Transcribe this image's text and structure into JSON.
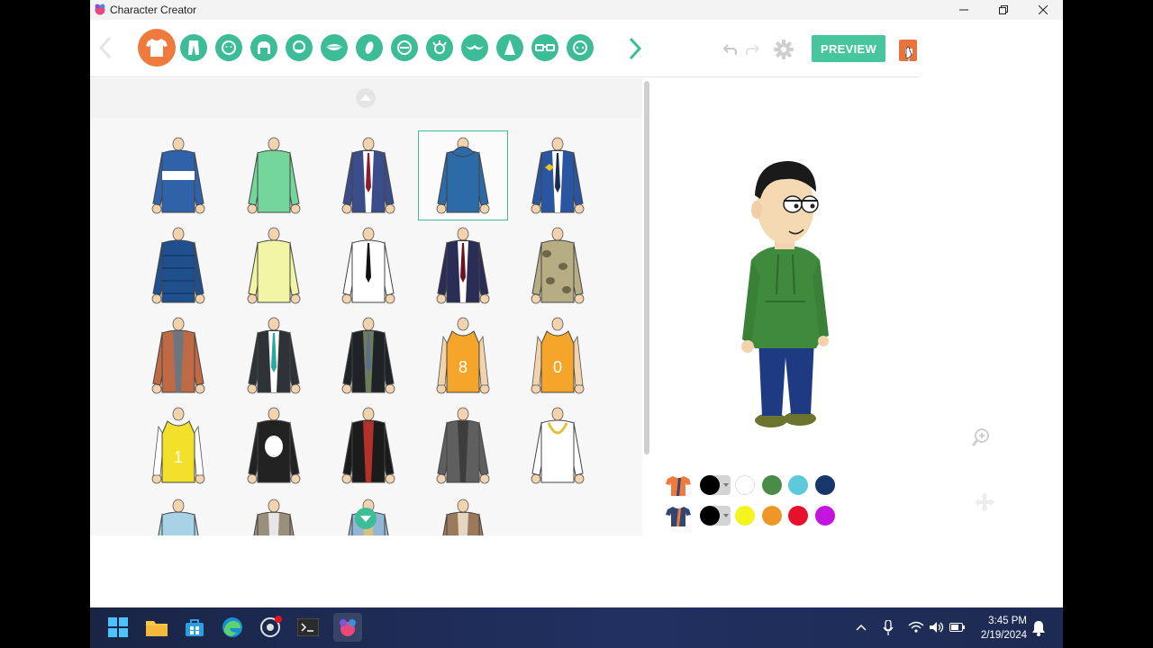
{
  "window": {
    "title": "Character Creator"
  },
  "toolbar": {
    "categories": [
      "shirt-icon",
      "pants-icon",
      "face-shape-icon",
      "hair-icon",
      "beard-icon",
      "mouth-icon",
      "nose-icon",
      "eyebrow-icon",
      "eyes-icon",
      "eyelashes-icon",
      "hat-icon",
      "glasses-icon",
      "accessory-icon"
    ],
    "preview_label": "PREVIEW"
  },
  "closet": {
    "selected_index": 3,
    "items": [
      "striped-polo-shirt",
      "green-tshirt",
      "suit-jacket-red-tie",
      "blue-hoodie",
      "police-uniform",
      "puffer-jacket",
      "yellow-button-shirt",
      "tuxedo-white-shirt",
      "dark-tuxedo",
      "camo-hunter-jacket",
      "brown-overalls-shirt",
      "dark-suit-teal-tie",
      "zombie-suit",
      "orange-jersey-8",
      "orange-jersey-0",
      "yellow-jersey-1",
      "skull-tshirt",
      "biker-leather-jacket",
      "grey-robe",
      "white-tshirt-gold-chain",
      "light-blue-shirt",
      "vest-outfit",
      "denim-jacket",
      "brown-coat"
    ]
  },
  "colors": {
    "row1": [
      "#000000",
      "#ffffff",
      "#4a8b47",
      "#5ec9db",
      "#17366c"
    ],
    "row2": [
      "#000000",
      "#f4f41e",
      "#ef9629",
      "#e8112d",
      "#c513e0"
    ],
    "accent": "#3dbd97",
    "active": "#ef7a3e"
  },
  "taskbar": {
    "time": "3:45 PM",
    "date": "2/19/2024"
  }
}
